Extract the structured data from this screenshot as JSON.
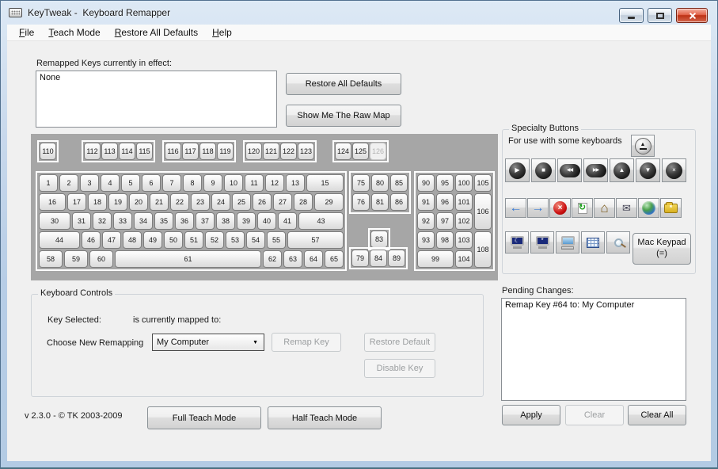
{
  "window": {
    "title": "KeyTweak -  Keyboard Remapper",
    "app_icon": "keyboard-icon",
    "controls": [
      "minimize",
      "maximize",
      "close"
    ]
  },
  "menu": {
    "items": [
      "File",
      "Teach Mode",
      "Restore All Defaults",
      "Help"
    ]
  },
  "remapped": {
    "label": "Remapped Keys currently in effect:",
    "value": "None",
    "restore_all_button": "Restore All Defaults",
    "raw_map_button": "Show Me The Raw Map"
  },
  "keyboard": {
    "function_groups": [
      [
        "110"
      ],
      [
        "112",
        "113",
        "114",
        "115"
      ],
      [
        "116",
        "117",
        "118",
        "119"
      ],
      [
        "120",
        "121",
        "122",
        "123"
      ],
      [
        "124",
        "125",
        "126"
      ]
    ],
    "main_rows": [
      [
        "1",
        "2",
        "3",
        "4",
        "5",
        "6",
        "7",
        "8",
        "9",
        "10",
        "11",
        "12",
        "13",
        "15"
      ],
      [
        "16",
        "17",
        "18",
        "19",
        "20",
        "21",
        "22",
        "23",
        "24",
        "25",
        "26",
        "27",
        "28",
        "29"
      ],
      [
        "30",
        "31",
        "32",
        "33",
        "34",
        "35",
        "36",
        "37",
        "38",
        "39",
        "40",
        "41",
        "43"
      ],
      [
        "44",
        "46",
        "47",
        "48",
        "49",
        "50",
        "51",
        "52",
        "53",
        "54",
        "55",
        "57"
      ],
      [
        "58",
        "59",
        "60",
        "61",
        "62",
        "63",
        "64",
        "65"
      ]
    ],
    "nav_rows": [
      [
        "75",
        "80",
        "85"
      ],
      [
        "76",
        "81",
        "86"
      ]
    ],
    "arrow_up_key": "83",
    "arrow_row": [
      "79",
      "84",
      "89"
    ],
    "numpad_keys": [
      "90",
      "95",
      "100",
      "105",
      "91",
      "96",
      "101",
      "106",
      "92",
      "97",
      "102",
      "93",
      "98",
      "103",
      "108",
      "99",
      "104"
    ],
    "disabled_keys": [
      "126"
    ]
  },
  "specialty": {
    "title": "Specialty Buttons",
    "subtitle": "For use with some keyboards",
    "eject_icon": "eject",
    "media_icons": [
      "play",
      "stop",
      "previous-track",
      "next-track",
      "volume-up",
      "volume-down",
      "mute"
    ],
    "browser_icons": [
      "back",
      "forward",
      "stop-browsing",
      "refresh",
      "home",
      "mail",
      "web",
      "favorites"
    ],
    "system_icons": [
      "monitor-sleep",
      "monitor-wake",
      "my-computer",
      "calculator",
      "search"
    ],
    "mac_keypad_label": "Mac Keypad (=)"
  },
  "controls": {
    "title": "Keyboard Controls",
    "key_selected_label": "Key Selected:",
    "mapped_label": "is currently mapped to:",
    "choose_label": "Choose New Remapping",
    "dropdown_value": "My Computer",
    "remap_button": "Remap Key",
    "restore_button": "Restore Default",
    "disable_button": "Disable Key"
  },
  "pending": {
    "label": "Pending Changes:",
    "items": [
      "Remap Key #64 to: My Computer"
    ],
    "apply_button": "Apply",
    "clear_button": "Clear",
    "clear_all_button": "Clear All"
  },
  "footer": {
    "version": "v 2.3.0 - © TK 2003-2009",
    "full_teach_button": "Full Teach Mode",
    "half_teach_button": "Half Teach Mode"
  },
  "colors": {
    "close_button_red": "#c6361a",
    "nav_arrow_blue": "#3a7bd4",
    "stop_red": "#cc1111",
    "folder_yellow": "#e8c23a",
    "globe_blue": "#2d6fc1",
    "keyboard_panel_gray": "#a6a6a6",
    "frame_blue": "#b7cde6"
  }
}
